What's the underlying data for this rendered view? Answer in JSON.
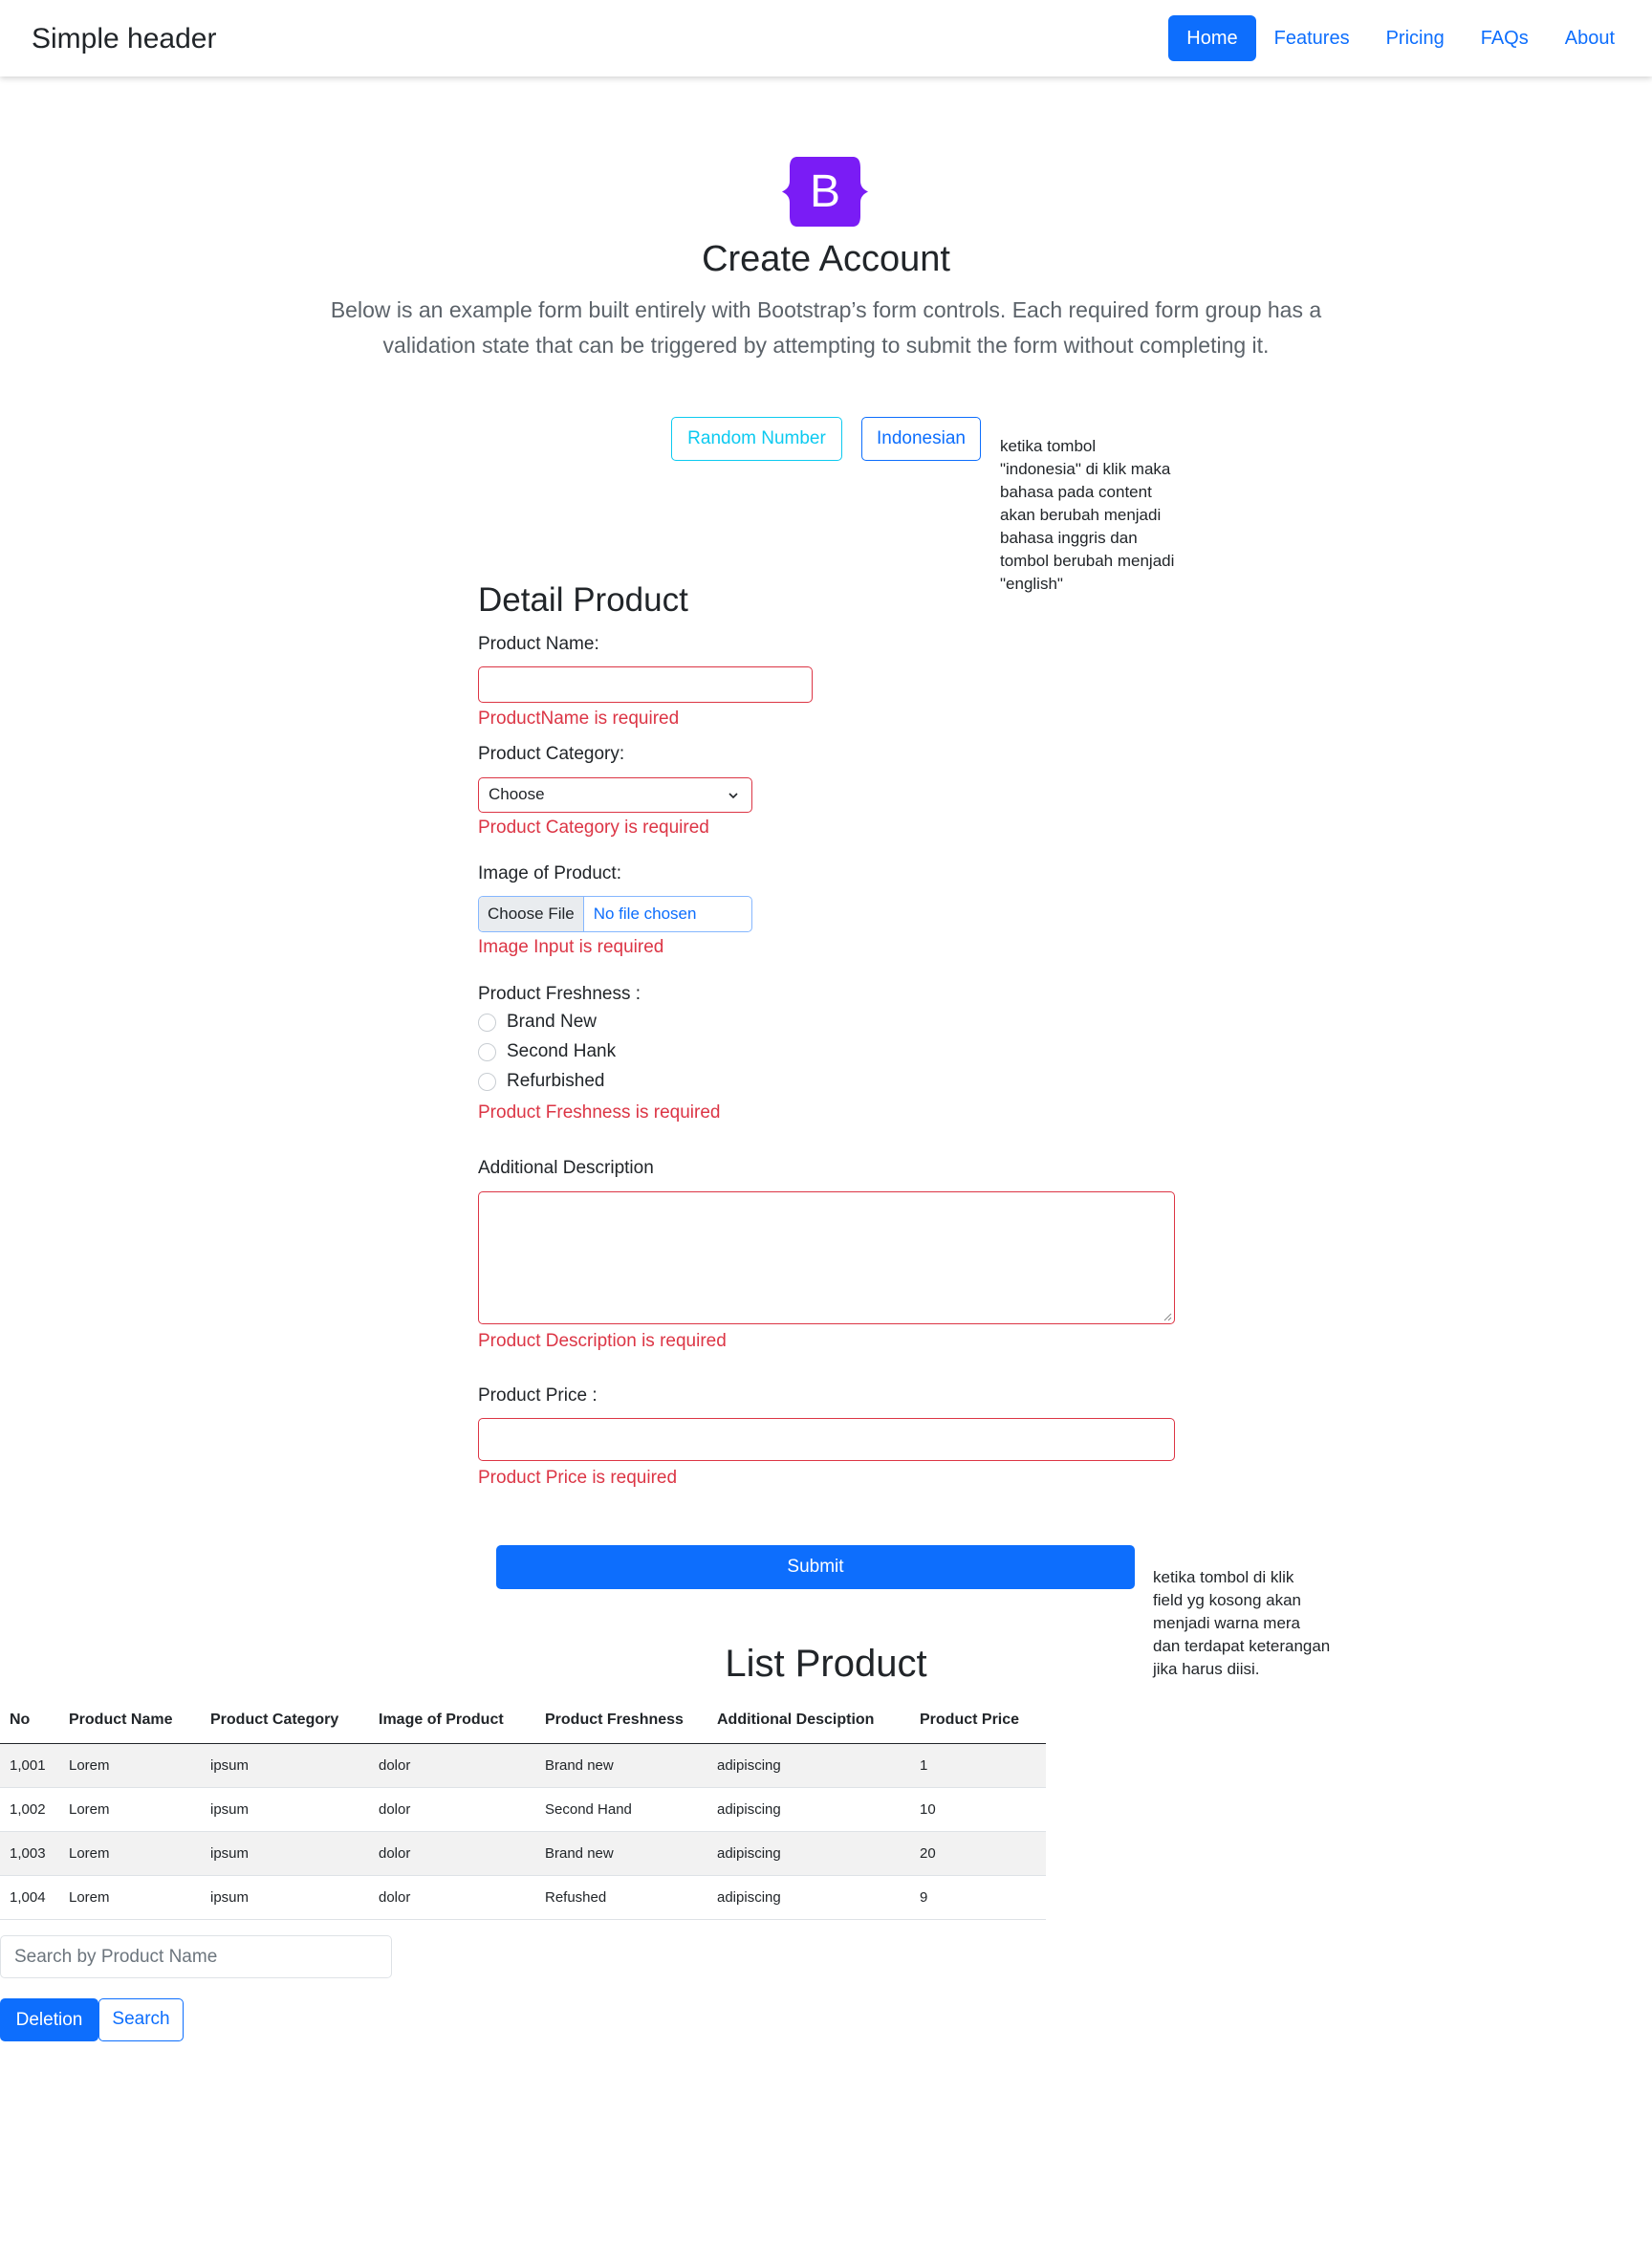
{
  "header": {
    "brand": "Simple header",
    "nav": [
      {
        "label": "Home",
        "active": true
      },
      {
        "label": "Features",
        "active": false
      },
      {
        "label": "Pricing",
        "active": false
      },
      {
        "label": "FAQs",
        "active": false
      },
      {
        "label": "About",
        "active": false
      }
    ]
  },
  "hero": {
    "logo_letter": "B",
    "logo_color": "#7a1cf5",
    "title": "Create Account",
    "lead_line1": "Below is an example form built entirely with Bootstrap’s form controls. Each required form group has a",
    "lead_line2": "validation state that can be triggered by attempting to submit the form without completing it."
  },
  "actions": {
    "random_number_label": "Random Number",
    "language_label": "Indonesian",
    "language_note": [
      "ketika tombol",
      "\"indonesia\" di klik maka",
      "bahasa pada content",
      "akan berubah menjadi",
      "bahasa inggris dan",
      "tombol berubah menjadi",
      "\"english\""
    ]
  },
  "form": {
    "section_title": "Detail Product",
    "product_name": {
      "label": "Product Name:",
      "value": "",
      "error": "ProductName is required"
    },
    "product_category": {
      "label": "Product Category:",
      "selected": "Choose",
      "error": "Product Category is required"
    },
    "image": {
      "label": "Image of Product:",
      "button": "Choose File",
      "status": "No file chosen",
      "error": "Image Input is required"
    },
    "freshness": {
      "label": "Product Freshness :",
      "options": [
        "Brand New",
        "Second Hank",
        "Refurbished"
      ],
      "error": "Product Freshness is required"
    },
    "description": {
      "label": "Additional Description",
      "value": "",
      "error": "Product Description is required"
    },
    "price": {
      "label": "Product Price :",
      "value": "",
      "error": "Product Price is required"
    },
    "submit_label": "Submit",
    "submit_note": [
      "ketika tombol di klik",
      "field yg kosong akan",
      "menjadi warna mera",
      "dan terdapat keterangan",
      "jika harus diisi."
    ]
  },
  "list": {
    "title": "List Product",
    "columns": [
      "No",
      "Product Name",
      "Product Category",
      "Image of Product",
      "Product Freshness",
      "Additional Desciption",
      "Product Price"
    ],
    "rows": [
      [
        "1,001",
        "Lorem",
        "ipsum",
        "dolor",
        "Brand new",
        "adipiscing",
        "1"
      ],
      [
        "1,002",
        "Lorem",
        "ipsum",
        "dolor",
        "Second Hand",
        "adipiscing",
        "10"
      ],
      [
        "1,003",
        "Lorem",
        "ipsum",
        "dolor",
        "Brand new",
        "adipiscing",
        "20"
      ],
      [
        "1,004",
        "Lorem",
        "ipsum",
        "dolor",
        "Refushed",
        "adipiscing",
        "9"
      ]
    ],
    "search_placeholder": "Search by Product Name",
    "delete_label": "Deletion",
    "search_label": "Search"
  },
  "colors": {
    "primary": "#0d6efd",
    "info": "#0dcaf0",
    "danger": "#dc3545"
  }
}
